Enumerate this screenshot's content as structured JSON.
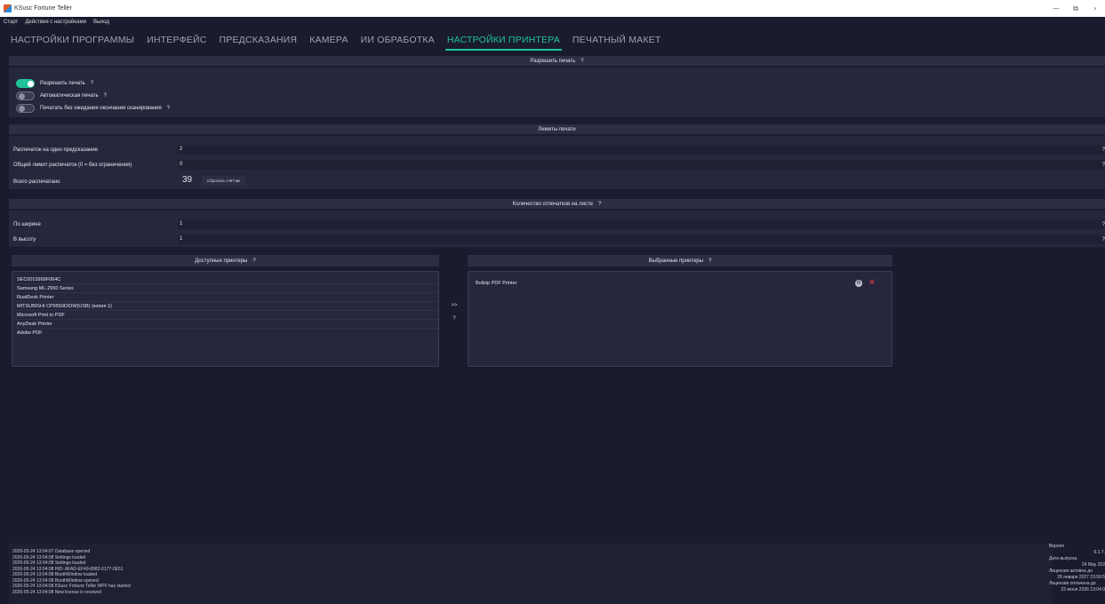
{
  "window": {
    "title": "KSusc Fortune Teller",
    "controls": [
      "—",
      "⧉",
      "›"
    ]
  },
  "menu": [
    "Старт",
    "Действия с настройками",
    "Выход"
  ],
  "tabs": [
    {
      "label": "НАСТРОЙКИ ПРОГРАММЫ",
      "active": false
    },
    {
      "label": "ИНТЕРФЕЙС",
      "active": false
    },
    {
      "label": "ПРЕДСКАЗАНИЯ",
      "active": false
    },
    {
      "label": "КАМЕРА",
      "active": false
    },
    {
      "label": "ИИ ОБРАБОТКА",
      "active": false
    },
    {
      "label": "НАСТРОЙКИ ПРИНТЕРА",
      "active": true
    },
    {
      "label": "ПЕЧАТНЫЙ МАКЕТ",
      "active": false
    }
  ],
  "print_section": {
    "title": "Разрешить печать",
    "help": "?",
    "toggles": [
      {
        "label": "Разрешить печать",
        "on": true,
        "help": "?"
      },
      {
        "label": "Автоматическая печать",
        "on": false,
        "help": "?"
      },
      {
        "label": "Печатать без ожидания окончания сканирования",
        "on": false,
        "help": "?"
      }
    ]
  },
  "limits_section": {
    "title": "Лимиты печати",
    "per_prediction_label": "Распечаток на одно предсказание",
    "per_prediction_value": "2",
    "total_limit_label": "Общий лимит распечаток (0 = без ограничения)",
    "total_limit_value": "0",
    "printed_label": "Всего распечатано",
    "printed_value": "39",
    "reset_label": "Сбросить счётчик",
    "help": "?"
  },
  "sheet_section": {
    "title": "Количество отпечатков на листе",
    "help": "?",
    "width_label": "По ширине",
    "width_value": "1",
    "height_label": "В высоту",
    "height_value": "1"
  },
  "available_printers": {
    "title": "Доступные принтеры",
    "help": "?",
    "items": [
      "SEC0015999F064C",
      "Samsung ML-2950 Series",
      "RustDesk Printer",
      "MITSUBISHI CP9550D/DW(USB) (копия 1)",
      "Microsoft Print to PDF",
      "AnyDesk Printer",
      "Adobe PDF"
    ]
  },
  "move": {
    "add_label": ">>",
    "help": "?"
  },
  "selected_printers": {
    "title": "Выбранные принтеры",
    "help": "?",
    "items": [
      "Bullzip PDF Printer"
    ]
  },
  "log": [
    "2026-05-24 13:04:07 Database opened",
    "2026-05-24 13:04:08 Settings loaded",
    "2026-05-24 13:04:08 Settings loaded",
    "2026-05-24 13:04:08 HID: AFAD-EF49-8982-0177-0E51",
    "2026-05-24 13:04:08 BoothWindow loaded",
    "2026-05-24 13:04:08 BoothWindow opened",
    "2026-05-24 13:04:08 KSusc Fortune Teller WPF has started",
    "2026-05-24 13:04:08 New license is received"
  ],
  "info": {
    "version_label": "Версия",
    "version_value": "0.1.7.",
    "release_label": "Дата выпуска",
    "release_value": "24 May 202",
    "license_active_label": "Лицензия активна до",
    "license_active_value": "28 января 2027 23:59:5",
    "license_paid_label": "Лицензия оплачена до",
    "license_paid_value": "23 июня 2026 13:04:0"
  },
  "colors": {
    "accent": "#1fc39a",
    "background": "#1a1b2e",
    "panel": "#25273d",
    "header": "#2c2e45",
    "danger": "#e53946"
  }
}
